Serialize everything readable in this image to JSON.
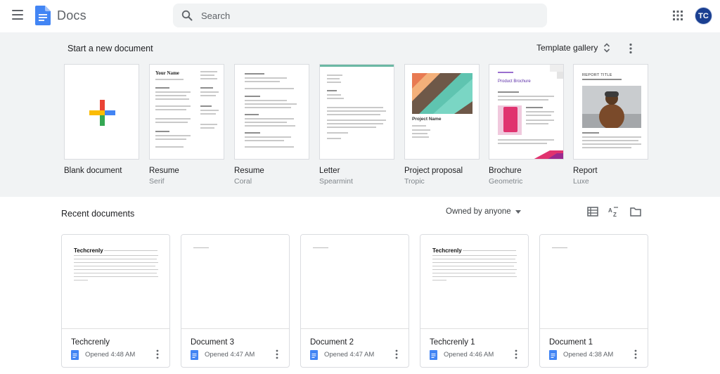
{
  "header": {
    "app_title": "Docs",
    "search_placeholder": "Search",
    "avatar_initials": "TC"
  },
  "templates": {
    "heading": "Start a new document",
    "gallery_label": "Template gallery",
    "items": [
      {
        "name": "Blank document",
        "sub": ""
      },
      {
        "name": "Resume",
        "sub": "Serif"
      },
      {
        "name": "Resume",
        "sub": "Coral"
      },
      {
        "name": "Letter",
        "sub": "Spearmint"
      },
      {
        "name": "Project proposal",
        "sub": "Tropic"
      },
      {
        "name": "Brochure",
        "sub": "Geometric"
      },
      {
        "name": "Report",
        "sub": "Luxe"
      }
    ],
    "thumb_text": {
      "resume_name": "Your Name",
      "project_name": "Project Name",
      "brochure_title": "Product Brochure",
      "report_title": "REPORT TITLE"
    }
  },
  "recent": {
    "heading": "Recent documents",
    "owner_filter": "Owned by anyone",
    "documents": [
      {
        "name": "Techcrenly",
        "opened": "Opened 4:48 AM",
        "preview_title": "Techcrenly"
      },
      {
        "name": "Document 3",
        "opened": "Opened 4:47 AM",
        "preview_title": ""
      },
      {
        "name": "Document 2",
        "opened": "Opened 4:47 AM",
        "preview_title": ""
      },
      {
        "name": "Techcrenly 1",
        "opened": "Opened 4:46 AM",
        "preview_title": "Techcrenly"
      },
      {
        "name": "Document 1",
        "opened": "Opened 4:38 AM",
        "preview_title": ""
      }
    ]
  },
  "colors": {
    "accent_blue": "#4285f4",
    "avatar_bg": "#1a3f91",
    "section_bg": "#f1f3f4"
  },
  "icons": [
    "menu-icon",
    "docs-logo-icon",
    "search-icon",
    "apps-grid-icon",
    "unfold-icon",
    "more-vert-icon",
    "list-view-icon",
    "sort-az-icon",
    "folder-icon",
    "doc-file-icon",
    "dropdown-arrow-icon",
    "plus-icon"
  ]
}
